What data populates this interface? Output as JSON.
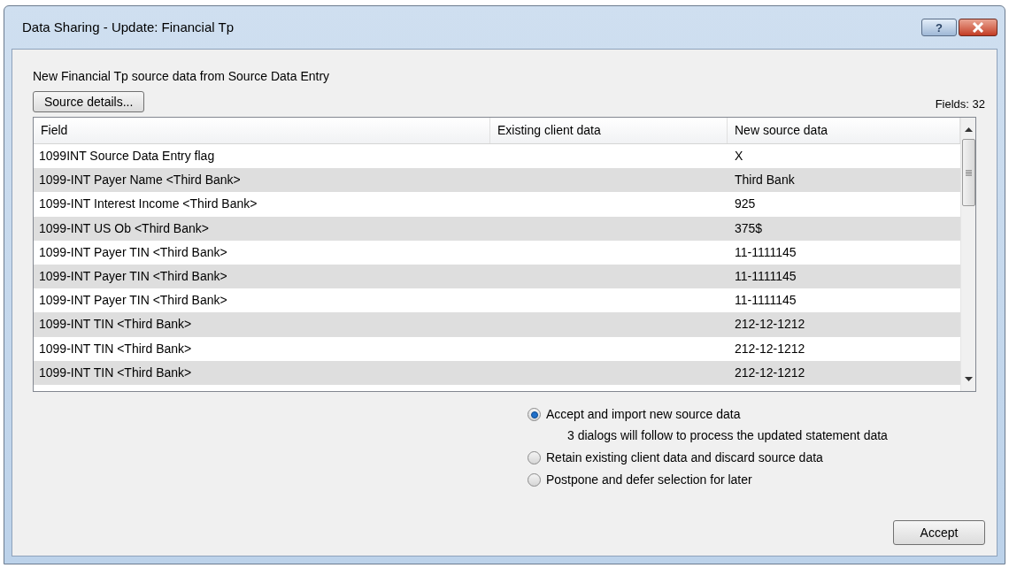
{
  "window": {
    "title": "Data Sharing - Update:  Financial Tp",
    "help_button": "?"
  },
  "description": "New Financial Tp source data from Source Data Entry",
  "source_details_button": "Source details...",
  "fields_count": "Fields:  32",
  "table": {
    "columns": [
      "Field",
      "Existing client data",
      "New source data"
    ],
    "rows": [
      {
        "field": "1099INT Source Data Entry flag",
        "new": "X"
      },
      {
        "field": "1099-INT Payer Name <Third Bank>",
        "new": "Third Bank"
      },
      {
        "field": "1099-INT Interest Income <Third Bank>",
        "new": "925"
      },
      {
        "field": "1099-INT US Ob <Third Bank>",
        "new": "375$"
      },
      {
        "field": "1099-INT Payer TIN <Third Bank>",
        "new": "11-1111145"
      },
      {
        "field": "1099-INT Payer TIN <Third Bank>",
        "new": "11-1111145"
      },
      {
        "field": "1099-INT Payer TIN <Third Bank>",
        "new": "11-1111145"
      },
      {
        "field": "1099-INT TIN <Third Bank>",
        "new": "212-12-1212"
      },
      {
        "field": "1099-INT TIN <Third Bank>",
        "new": "212-12-1212"
      },
      {
        "field": "1099-INT TIN <Third Bank>",
        "new": "212-12-1212"
      }
    ]
  },
  "options": [
    {
      "label": "Accept and import new source data",
      "note": "3 dialogs will follow to process the updated statement data",
      "selected": true
    },
    {
      "label": "Retain existing client data and discard source data",
      "selected": false
    },
    {
      "label": "Postpone and defer selection for later",
      "selected": false
    }
  ],
  "accept_button": "Accept"
}
